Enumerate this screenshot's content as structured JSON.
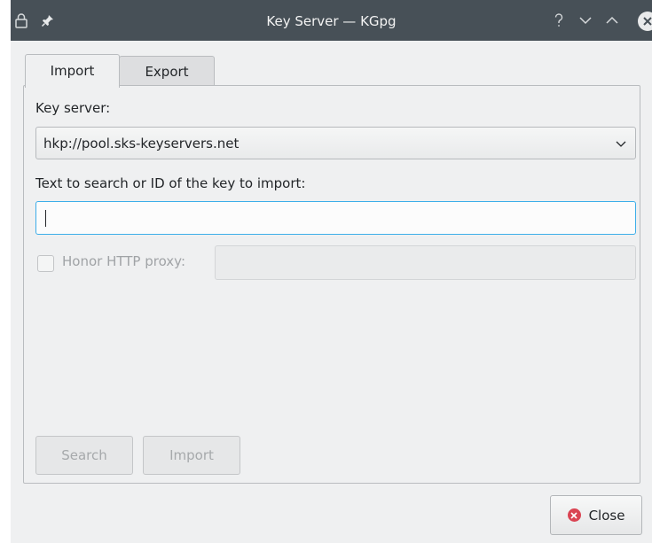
{
  "window": {
    "title": "Key Server — KGpg"
  },
  "titlebar_icons": [
    "lock-icon",
    "pin-icon",
    "help-icon",
    "minimize-icon",
    "maximize-icon",
    "close-icon"
  ],
  "tabs": [
    {
      "label": "Import",
      "active": true
    },
    {
      "label": "Export",
      "active": false
    }
  ],
  "import": {
    "keyserver_label": "Key server:",
    "keyserver_value": "hkp://pool.sks-keyservers.net",
    "search_label": "Text to search or ID of the key to import:",
    "search_value": "",
    "proxy_label": "Honor HTTP proxy:",
    "proxy_checked": false,
    "proxy_value": "",
    "search_button": "Search",
    "import_button": "Import"
  },
  "footer": {
    "close_button": "Close"
  },
  "colors": {
    "titlebar": "#475057",
    "focus": "#3daee9",
    "close_icon": "#da4453"
  }
}
